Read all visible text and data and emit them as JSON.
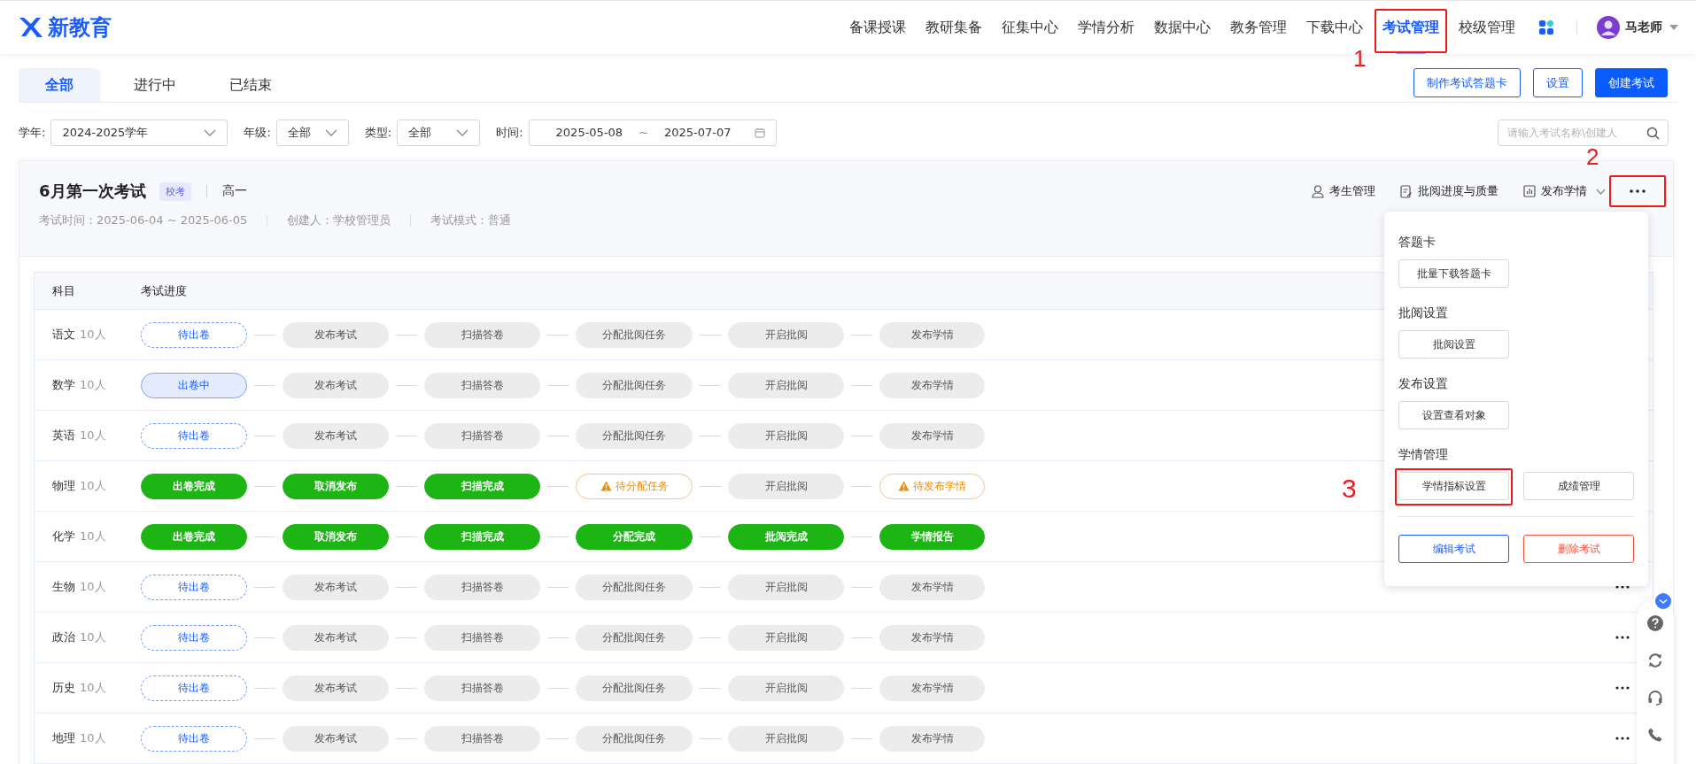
{
  "header": {
    "logo": "新教育",
    "nav": [
      {
        "label": "备课授课",
        "selected": false
      },
      {
        "label": "教研集备",
        "selected": false
      },
      {
        "label": "征集中心",
        "selected": false
      },
      {
        "label": "学情分析",
        "selected": false
      },
      {
        "label": "数据中心",
        "selected": false
      },
      {
        "label": "教务管理",
        "selected": false
      },
      {
        "label": "下载中心",
        "selected": false
      },
      {
        "label": "考试管理",
        "selected": true,
        "callout": "1"
      },
      {
        "label": "校级管理",
        "selected": false
      }
    ],
    "user": "马老师"
  },
  "tabs": [
    {
      "label": "全部",
      "selected": true
    },
    {
      "label": "进行中",
      "selected": false
    },
    {
      "label": "已结束",
      "selected": false
    }
  ],
  "actions": [
    {
      "label": "制作考试答题卡",
      "kind": "outline"
    },
    {
      "label": "设置",
      "kind": "outline"
    },
    {
      "label": "创建考试",
      "kind": "primary"
    }
  ],
  "filters": [
    {
      "label": "学年:",
      "value": "2024-2025学年"
    },
    {
      "label": "年级:",
      "value": "全部"
    },
    {
      "label": "类型:",
      "value": "全部"
    }
  ],
  "date_range": {
    "label": "时间:",
    "start": "2025-05-08",
    "separator": "~",
    "end": "2025-07-07"
  },
  "search": {
    "placeholder": "请输入考试名称\\创建人"
  },
  "exam": {
    "title": "6月第一次考试",
    "tag": "校考",
    "grade": "高一",
    "meta": [
      "考试时间：2025-06-04 ~ 2025-06-05",
      "创建人：学校管理员",
      "考试模式：普通"
    ],
    "tools": [
      {
        "label": "考生管理",
        "dropdown": false
      },
      {
        "label": "批阅进度与质量",
        "dropdown": false
      },
      {
        "label": "发布学情",
        "dropdown": true
      }
    ],
    "more_callout": "2"
  },
  "table": {
    "columns": [
      "科目",
      "考试进度"
    ],
    "rows": [
      {
        "subject": "语文",
        "count": "10人",
        "stages": [
          {
            "label": "待出卷",
            "kind": "pending"
          },
          {
            "label": "发布考试",
            "kind": "todo"
          },
          {
            "label": "扫描答卷",
            "kind": "todo"
          },
          {
            "label": "分配批阅任务",
            "kind": "todo"
          },
          {
            "label": "开启批阅",
            "kind": "todo"
          },
          {
            "label": "发布学情",
            "kind": "todo"
          }
        ]
      },
      {
        "subject": "数学",
        "count": "10人",
        "stages": [
          {
            "label": "出卷中",
            "kind": "active"
          },
          {
            "label": "发布考试",
            "kind": "todo"
          },
          {
            "label": "扫描答卷",
            "kind": "todo"
          },
          {
            "label": "分配批阅任务",
            "kind": "todo"
          },
          {
            "label": "开启批阅",
            "kind": "todo"
          },
          {
            "label": "发布学情",
            "kind": "todo"
          }
        ]
      },
      {
        "subject": "英语",
        "count": "10人",
        "stages": [
          {
            "label": "待出卷",
            "kind": "pending"
          },
          {
            "label": "发布考试",
            "kind": "todo"
          },
          {
            "label": "扫描答卷",
            "kind": "todo"
          },
          {
            "label": "分配批阅任务",
            "kind": "todo"
          },
          {
            "label": "开启批阅",
            "kind": "todo"
          },
          {
            "label": "发布学情",
            "kind": "todo"
          }
        ]
      },
      {
        "subject": "物理",
        "count": "10人",
        "stages": [
          {
            "label": "出卷完成",
            "kind": "done"
          },
          {
            "label": "取消发布",
            "kind": "done"
          },
          {
            "label": "扫描完成",
            "kind": "done"
          },
          {
            "label": "待分配任务",
            "kind": "warning"
          },
          {
            "label": "开启批阅",
            "kind": "todo"
          },
          {
            "label": "待发布学情",
            "kind": "warning"
          }
        ]
      },
      {
        "subject": "化学",
        "count": "10人",
        "stages": [
          {
            "label": "出卷完成",
            "kind": "done"
          },
          {
            "label": "取消发布",
            "kind": "done"
          },
          {
            "label": "扫描完成",
            "kind": "done"
          },
          {
            "label": "分配完成",
            "kind": "done"
          },
          {
            "label": "批阅完成",
            "kind": "done"
          },
          {
            "label": "学情报告",
            "kind": "done"
          }
        ]
      },
      {
        "subject": "生物",
        "count": "10人",
        "show_more": true,
        "stages": [
          {
            "label": "待出卷",
            "kind": "pending"
          },
          {
            "label": "发布考试",
            "kind": "todo"
          },
          {
            "label": "扫描答卷",
            "kind": "todo"
          },
          {
            "label": "分配批阅任务",
            "kind": "todo"
          },
          {
            "label": "开启批阅",
            "kind": "todo"
          },
          {
            "label": "发布学情",
            "kind": "todo"
          }
        ]
      },
      {
        "subject": "政治",
        "count": "10人",
        "show_more": true,
        "stages": [
          {
            "label": "待出卷",
            "kind": "pending"
          },
          {
            "label": "发布考试",
            "kind": "todo"
          },
          {
            "label": "扫描答卷",
            "kind": "todo"
          },
          {
            "label": "分配批阅任务",
            "kind": "todo"
          },
          {
            "label": "开启批阅",
            "kind": "todo"
          },
          {
            "label": "发布学情",
            "kind": "todo"
          }
        ]
      },
      {
        "subject": "历史",
        "count": "10人",
        "show_more": true,
        "stages": [
          {
            "label": "待出卷",
            "kind": "pending"
          },
          {
            "label": "发布考试",
            "kind": "todo"
          },
          {
            "label": "扫描答卷",
            "kind": "todo"
          },
          {
            "label": "分配批阅任务",
            "kind": "todo"
          },
          {
            "label": "开启批阅",
            "kind": "todo"
          },
          {
            "label": "发布学情",
            "kind": "todo"
          }
        ]
      },
      {
        "subject": "地理",
        "count": "10人",
        "show_more": true,
        "stages": [
          {
            "label": "待出卷",
            "kind": "pending"
          },
          {
            "label": "发布考试",
            "kind": "todo"
          },
          {
            "label": "扫描答卷",
            "kind": "todo"
          },
          {
            "label": "分配批阅任务",
            "kind": "todo"
          },
          {
            "label": "开启批阅",
            "kind": "todo"
          },
          {
            "label": "发布学情",
            "kind": "todo"
          }
        ]
      }
    ]
  },
  "menu": {
    "sections": [
      {
        "title": "答题卡",
        "buttons": [
          {
            "label": "批量下载答题卡"
          }
        ]
      },
      {
        "title": "批阅设置",
        "buttons": [
          {
            "label": "批阅设置"
          }
        ]
      },
      {
        "title": "发布设置",
        "buttons": [
          {
            "label": "设置查看对象"
          }
        ]
      },
      {
        "title": "学情管理",
        "buttons": [
          {
            "label": "学情指标设置",
            "callout": "3"
          },
          {
            "label": "成绩管理"
          }
        ]
      }
    ],
    "footer": [
      {
        "label": "编辑考试",
        "kind": "primary"
      },
      {
        "label": "删除考试",
        "kind": "danger"
      }
    ]
  }
}
